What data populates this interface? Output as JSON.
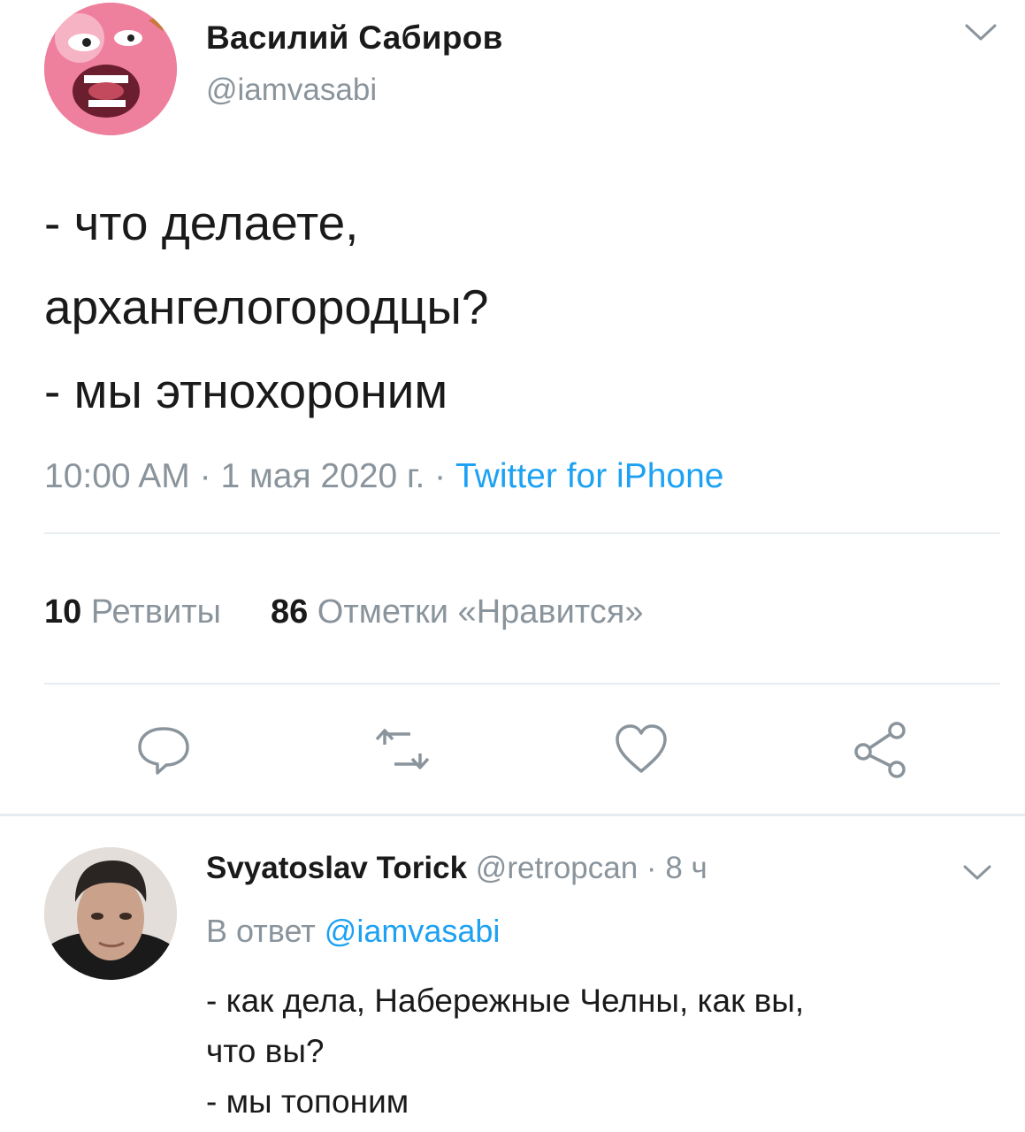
{
  "tweet": {
    "author_name": "Василий Сабиров",
    "author_handle": "@iamvasabi",
    "text": "- что делаете,\nархангелогородцы?\n- мы этнохороним",
    "time": "10:00 AM",
    "dot1": " · ",
    "date": "1 мая 2020 г.",
    "dot2": " · ",
    "source": "Twitter for iPhone",
    "retweets_count": "10",
    "retweets_label": "Ретвиты",
    "likes_count": "86",
    "likes_label": "Отметки «Нравится»",
    "actions": [
      "reply-icon",
      "retweet-icon",
      "like-icon",
      "share-icon"
    ]
  },
  "reply": {
    "author_name": "Svyatoslav Torick",
    "author_handle": "@retropcan",
    "dot": " · ",
    "age": "8 ч",
    "reply_to_label": "В ответ",
    "reply_to_mention": "@iamvasabi",
    "text": "- как дела, Набережные Челны, как вы,\nчто вы?\n - мы топоним"
  },
  "colors": {
    "accent": "#1da1f2",
    "secondary_text": "#8a949c",
    "primary_text": "#1a1a1a",
    "divider": "#e6ecf0"
  }
}
